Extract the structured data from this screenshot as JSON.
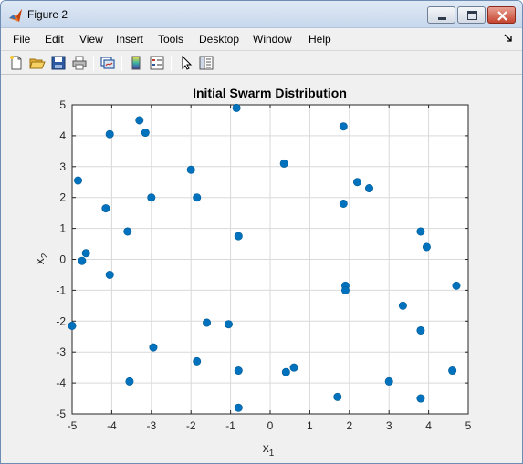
{
  "window": {
    "title": "Figure 2"
  },
  "menubar": {
    "items": [
      "File",
      "Edit",
      "View",
      "Insert",
      "Tools",
      "Desktop",
      "Window",
      "Help"
    ]
  },
  "toolbar": {
    "icons": [
      "new-figure-icon",
      "open-file-icon",
      "save-icon",
      "print-icon",
      "link-plot-icon",
      "insert-colorbar-icon",
      "insert-legend-icon",
      "edit-plot-icon",
      "property-inspector-icon"
    ]
  },
  "colors": {
    "marker": "#0072bd",
    "grid": "#d9d9d9",
    "axes_bg": "#ffffff",
    "figure_bg": "#f0f0f0"
  },
  "chart_data": {
    "type": "scatter",
    "title": "Initial Swarm Distribution",
    "xlabel_base": "x",
    "xlabel_sub": "1",
    "ylabel_base": "x",
    "ylabel_sub": "2",
    "xlim": [
      -5,
      5
    ],
    "ylim": [
      -5,
      5
    ],
    "xticks": [
      -5,
      -4,
      -3,
      -2,
      -1,
      0,
      1,
      2,
      3,
      4,
      5
    ],
    "yticks": [
      -5,
      -4,
      -3,
      -2,
      -1,
      0,
      1,
      2,
      3,
      4,
      5
    ],
    "grid": true,
    "legend": false,
    "points": [
      {
        "x": -3.3,
        "y": 4.5
      },
      {
        "x": -4.05,
        "y": 4.05
      },
      {
        "x": -3.15,
        "y": 4.1
      },
      {
        "x": -0.85,
        "y": 4.9
      },
      {
        "x": 1.85,
        "y": 4.3
      },
      {
        "x": -2.0,
        "y": 2.9
      },
      {
        "x": 0.35,
        "y": 3.1
      },
      {
        "x": -4.85,
        "y": 2.55
      },
      {
        "x": -3.0,
        "y": 2.0
      },
      {
        "x": -1.85,
        "y": 2.0
      },
      {
        "x": 2.2,
        "y": 2.5
      },
      {
        "x": 2.5,
        "y": 2.3
      },
      {
        "x": 1.85,
        "y": 1.8
      },
      {
        "x": -4.15,
        "y": 1.65
      },
      {
        "x": -3.6,
        "y": 0.9
      },
      {
        "x": -0.8,
        "y": 0.75
      },
      {
        "x": 3.8,
        "y": 0.9
      },
      {
        "x": 3.95,
        "y": 0.4
      },
      {
        "x": -4.65,
        "y": 0.2
      },
      {
        "x": -4.75,
        "y": -0.05
      },
      {
        "x": -4.05,
        "y": -0.5
      },
      {
        "x": 4.7,
        "y": -0.85
      },
      {
        "x": 1.9,
        "y": -0.85
      },
      {
        "x": 1.9,
        "y": -1.0
      },
      {
        "x": 3.35,
        "y": -1.5
      },
      {
        "x": -5.0,
        "y": -2.15
      },
      {
        "x": -1.6,
        "y": -2.05
      },
      {
        "x": -1.05,
        "y": -2.1
      },
      {
        "x": 3.8,
        "y": -2.3
      },
      {
        "x": -2.95,
        "y": -2.85
      },
      {
        "x": -1.85,
        "y": -3.3
      },
      {
        "x": -0.8,
        "y": -3.6
      },
      {
        "x": 0.4,
        "y": -3.65
      },
      {
        "x": 0.6,
        "y": -3.5
      },
      {
        "x": 4.6,
        "y": -3.6
      },
      {
        "x": -3.55,
        "y": -3.95
      },
      {
        "x": 3.0,
        "y": -3.95
      },
      {
        "x": 1.7,
        "y": -4.45
      },
      {
        "x": 3.8,
        "y": -4.5
      },
      {
        "x": -0.8,
        "y": -4.8
      }
    ]
  }
}
